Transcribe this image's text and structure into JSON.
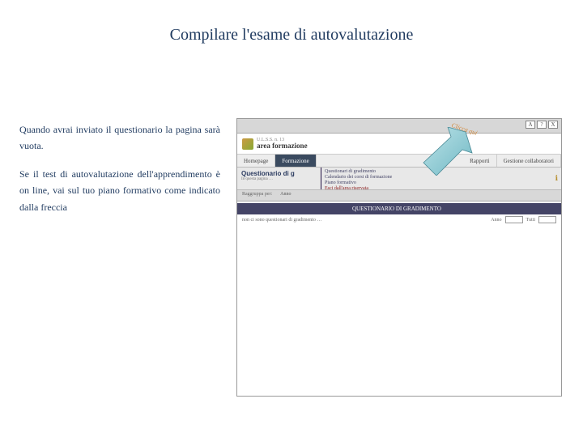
{
  "title": "Compilare l'esame di autovalutazione",
  "paragraphs": {
    "p1": "Quando avrai inviato il questionario la pagina sarà vuota.",
    "p2": "Se il test di autovalutazione dell'apprendimento è on line, vai sul tuo piano formativo come indicato dalla freccia"
  },
  "arrow_label": "Clicca qui",
  "screenshot": {
    "top_controls": {
      "a": "A",
      "b": "?",
      "c": "X"
    },
    "logo_sub": "U.L.S.S. n. 13",
    "logo_main": "area formazione",
    "tabs": {
      "homepage": "Homepage",
      "formazione": "Formazione",
      "rapporti": "Rapporti",
      "gestione": "Gestione collaboratori"
    },
    "sub_title": "Questionario di g",
    "sub_caption": "In questa pagina …",
    "sub_nav": {
      "n1": "Questionari di gradimento",
      "n2": "Calendario dei corsi di formazione",
      "n3": "Piano formativo",
      "n4": "Esci dall'area riservata"
    },
    "info_raggruppa": "Raggruppa per:",
    "info_anno": "Anno",
    "section_title": "QUESTIONARIO DI GRADIMENTO",
    "detail_text": "non ci sono questionari di gradimento …",
    "select_anno": "Anno",
    "select_tutti": "Tutti"
  }
}
